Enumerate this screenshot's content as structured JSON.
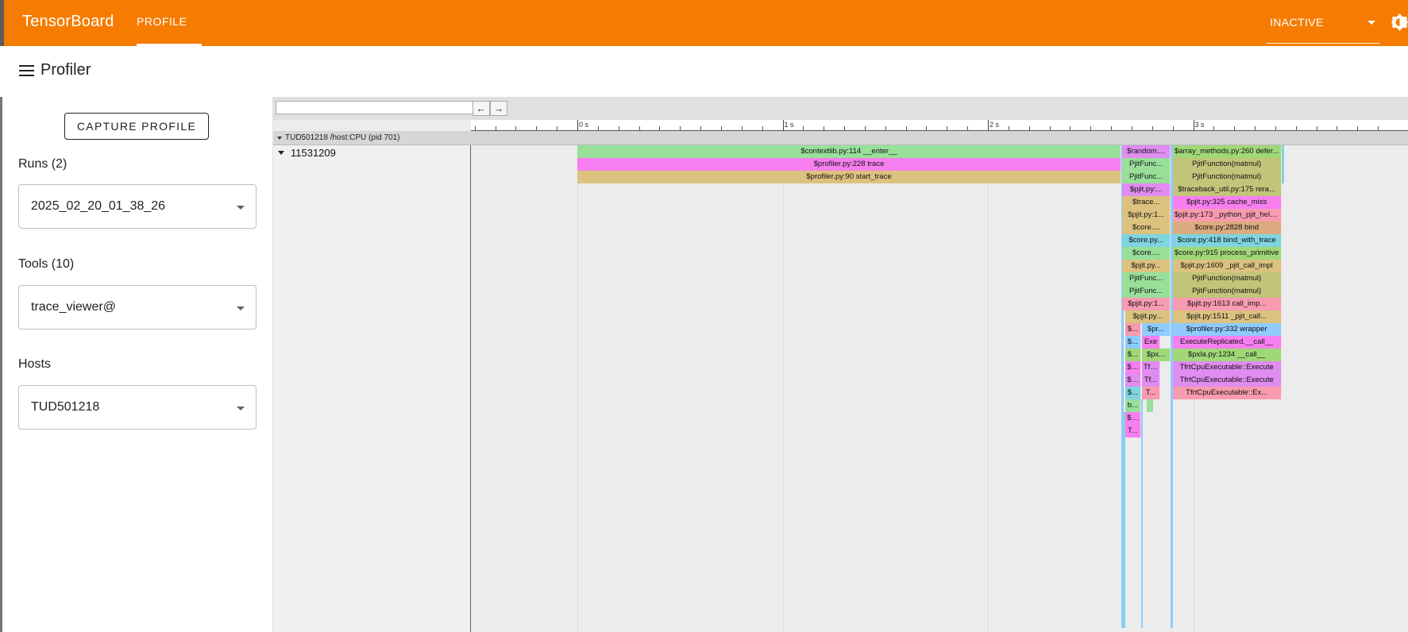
{
  "app": {
    "title": "TensorBoard",
    "tab": "PROFILE",
    "status_select": "INACTIVE",
    "accent_color": "#f57c00"
  },
  "page": {
    "title": "Profiler"
  },
  "sidebar": {
    "capture_button": "CAPTURE PROFILE",
    "runs_label": "Runs (2)",
    "runs_value": "2025_02_20_01_38_26",
    "tools_label": "Tools (10)",
    "tools_value": "trace_viewer@",
    "hosts_label": "Hosts",
    "hosts_value": "TUD501218"
  },
  "trace_viewer": {
    "search_placeholder": "",
    "prev_button": "←",
    "next_button": "→",
    "ruler_labels": [
      "0 s",
      "1 s",
      "2 s",
      "3 s"
    ],
    "process_label": "TUD501218 /host:CPU (pid 701)",
    "thread_label": "11531209",
    "slices": [
      {
        "label": "$contextlib.py:114 __enter__",
        "start": 0.0,
        "end": 2.65,
        "depth": 0,
        "color": "#98df9a"
      },
      {
        "label": "$profiler.py:228 trace",
        "start": 0.0,
        "end": 2.65,
        "depth": 1,
        "color": "#f77ff0"
      },
      {
        "label": "$profiler.py:90 start_trace",
        "start": 0.0,
        "end": 2.65,
        "depth": 2,
        "color": "#dbc27f"
      },
      {
        "label": "$random....",
        "start": 2.655,
        "end": 2.89,
        "depth": 0,
        "color": "#e08cf0"
      },
      {
        "label": "PjitFunc...",
        "start": 2.655,
        "end": 2.89,
        "depth": 1,
        "color": "#98df9a"
      },
      {
        "label": "PjitFunc...",
        "start": 2.655,
        "end": 2.89,
        "depth": 2,
        "color": "#98df9a"
      },
      {
        "label": "$pjit.py:...",
        "start": 2.655,
        "end": 2.89,
        "depth": 3,
        "color": "#e08cf0"
      },
      {
        "label": "$trace...",
        "start": 2.655,
        "end": 2.89,
        "depth": 4,
        "color": "#dbc27f"
      },
      {
        "label": "$pjit.py:1...",
        "start": 2.655,
        "end": 2.89,
        "depth": 5,
        "color": "#dbc27f"
      },
      {
        "label": "$core....",
        "start": 2.655,
        "end": 2.89,
        "depth": 6,
        "color": "#dbc27f"
      },
      {
        "label": "$core.py...",
        "start": 2.655,
        "end": 2.89,
        "depth": 7,
        "color": "#7fd4e0"
      },
      {
        "label": "$core....",
        "start": 2.655,
        "end": 2.89,
        "depth": 8,
        "color": "#98df9a"
      },
      {
        "label": "$pjit.py...",
        "start": 2.655,
        "end": 2.89,
        "depth": 9,
        "color": "#dbc27f"
      },
      {
        "label": "PjitFunc...",
        "start": 2.655,
        "end": 2.89,
        "depth": 10,
        "color": "#98df9a"
      },
      {
        "label": "PjitFunc...",
        "start": 2.655,
        "end": 2.89,
        "depth": 11,
        "color": "#98df9a"
      },
      {
        "label": "$pjit.py:1...",
        "start": 2.655,
        "end": 2.89,
        "depth": 12,
        "color": "#f99bb0"
      },
      {
        "label": "$pjit.py...",
        "start": 2.67,
        "end": 2.89,
        "depth": 13,
        "color": "#dbc27f"
      },
      {
        "label": "$...",
        "start": 2.67,
        "end": 2.745,
        "depth": 14,
        "color": "#f99bb0"
      },
      {
        "label": "$pr...",
        "start": 2.75,
        "end": 2.89,
        "depth": 14,
        "color": "#8fcbff"
      },
      {
        "label": "$...",
        "start": 2.67,
        "end": 2.745,
        "depth": 15,
        "color": "#8fcbff"
      },
      {
        "label": "Exe",
        "start": 2.75,
        "end": 2.84,
        "depth": 15,
        "color": "#f77ff0"
      },
      {
        "label": "$...",
        "start": 2.67,
        "end": 2.745,
        "depth": 16,
        "color": "#a0d878"
      },
      {
        "label": "$px...",
        "start": 2.75,
        "end": 2.89,
        "depth": 16,
        "color": "#a0d878"
      },
      {
        "label": "$co",
        "start": 2.67,
        "end": 2.745,
        "depth": 17,
        "color": "#f77ff0"
      },
      {
        "label": "Tfr...",
        "start": 2.75,
        "end": 2.84,
        "depth": 17,
        "color": "#e08cf0"
      },
      {
        "label": "$co",
        "start": 2.67,
        "end": 2.745,
        "depth": 18,
        "color": "#e08cf0"
      },
      {
        "label": "Tf...",
        "start": 2.75,
        "end": 2.84,
        "depth": 18,
        "color": "#e08cf0"
      },
      {
        "label": "$...",
        "start": 2.67,
        "end": 2.745,
        "depth": 19,
        "color": "#7fd4e0"
      },
      {
        "label": "T...",
        "start": 2.75,
        "end": 2.84,
        "depth": 19,
        "color": "#f99bb0"
      },
      {
        "label": "b...",
        "start": 2.67,
        "end": 2.745,
        "depth": 20,
        "color": "#98df9a"
      },
      {
        "label": "$co",
        "start": 2.67,
        "end": 2.745,
        "depth": 21,
        "color": "#f77ff0"
      },
      {
        "label": "T...",
        "start": 2.67,
        "end": 2.745,
        "depth": 22,
        "color": "#f77ff0"
      },
      {
        "label": "$array_methods.py:260 defer...",
        "start": 2.9,
        "end": 3.43,
        "depth": 0,
        "color": "#a0d878"
      },
      {
        "label": "PjitFunction(matmul)",
        "start": 2.9,
        "end": 3.43,
        "depth": 1,
        "color": "#c2c47a"
      },
      {
        "label": "PjitFunction(matmul)",
        "start": 2.9,
        "end": 3.43,
        "depth": 2,
        "color": "#c2c47a"
      },
      {
        "label": "$traceback_util.py:175 rera...",
        "start": 2.9,
        "end": 3.43,
        "depth": 3,
        "color": "#c2c47a"
      },
      {
        "label": "$pjit.py:325 cache_miss",
        "start": 2.9,
        "end": 3.43,
        "depth": 4,
        "color": "#f77ff0"
      },
      {
        "label": "$pjit.py:173 _python_pjit_helper",
        "start": 2.9,
        "end": 3.43,
        "depth": 5,
        "color": "#f99bb0"
      },
      {
        "label": "$core.py:2828 bind",
        "start": 2.9,
        "end": 3.43,
        "depth": 6,
        "color": "#dbab7f"
      },
      {
        "label": "$core.py:418 bind_with_trace",
        "start": 2.9,
        "end": 3.43,
        "depth": 7,
        "color": "#7fd4e0"
      },
      {
        "label": "$core.py:915 process_primitive",
        "start": 2.9,
        "end": 3.43,
        "depth": 8,
        "color": "#a0d878"
      },
      {
        "label": "$pjit.py:1609 _pjit_call_impl",
        "start": 2.9,
        "end": 3.43,
        "depth": 9,
        "color": "#dbc27f"
      },
      {
        "label": "PjitFunction(matmul)",
        "start": 2.9,
        "end": 3.43,
        "depth": 10,
        "color": "#c2c47a"
      },
      {
        "label": "PjitFunction(matmul)",
        "start": 2.9,
        "end": 3.43,
        "depth": 11,
        "color": "#c2c47a"
      },
      {
        "label": "$pjit.py:1613 call_imp...",
        "start": 2.9,
        "end": 3.43,
        "depth": 12,
        "color": "#f99bb0"
      },
      {
        "label": "$pjit.py:1511 _pjit_call...",
        "start": 2.9,
        "end": 3.43,
        "depth": 13,
        "color": "#dbc27f"
      },
      {
        "label": "$profiler.py:332 wrapper",
        "start": 2.9,
        "end": 3.43,
        "depth": 14,
        "color": "#8fcbff"
      },
      {
        "label": "ExecuteReplicated.__call__",
        "start": 2.9,
        "end": 3.43,
        "depth": 15,
        "color": "#f77ff0"
      },
      {
        "label": "$pxla.py:1234 __call__",
        "start": 2.9,
        "end": 3.43,
        "depth": 16,
        "color": "#a0d878"
      },
      {
        "label": "TfrtCpuExecutable::Execute",
        "start": 2.9,
        "end": 3.43,
        "depth": 17,
        "color": "#e08cf0"
      },
      {
        "label": "TfrtCpuExecutable::Execute",
        "start": 2.9,
        "end": 3.43,
        "depth": 18,
        "color": "#e08cf0"
      },
      {
        "label": "TfrtCpuExecutable::Ex...",
        "start": 2.9,
        "end": 3.43,
        "depth": 19,
        "color": "#f99bb0"
      }
    ]
  }
}
